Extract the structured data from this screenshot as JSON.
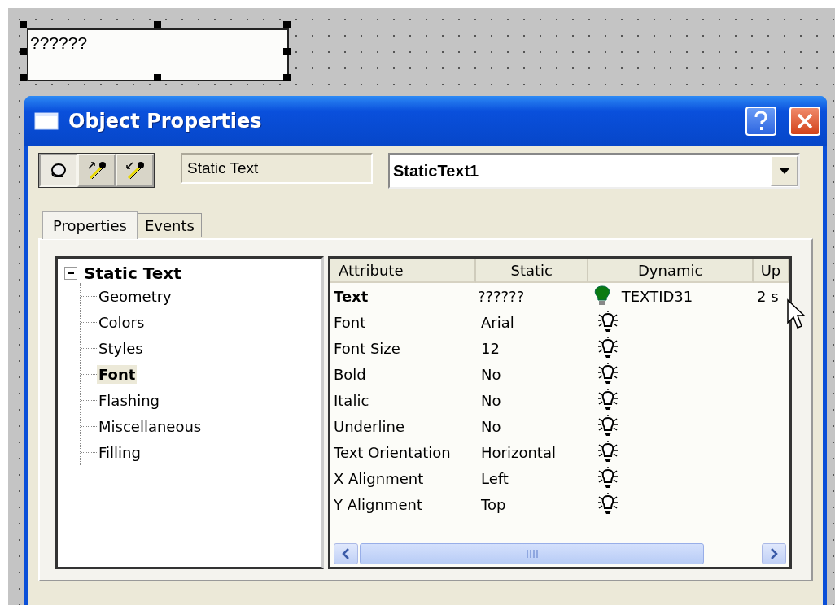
{
  "canvas": {
    "object_text": "??????",
    "object_selected": true
  },
  "window": {
    "title": "Object Properties"
  },
  "toolbar": {
    "buttons": [
      {
        "kind": "ball",
        "pressed": true
      },
      {
        "kind": "pipette-in",
        "pressed": false
      },
      {
        "kind": "pipette-out",
        "pressed": false
      }
    ],
    "object_type": "Static Text",
    "object_name": "StaticText1"
  },
  "tabs": [
    {
      "label": "Properties",
      "selected": true
    },
    {
      "label": "Events",
      "selected": false
    }
  ],
  "tree": {
    "label": "Static Text",
    "expanded": true,
    "children": [
      {
        "label": "Geometry",
        "selected": false
      },
      {
        "label": "Colors",
        "selected": false
      },
      {
        "label": "Styles",
        "selected": false
      },
      {
        "label": "Font",
        "selected": true
      },
      {
        "label": "Flashing",
        "selected": false
      },
      {
        "label": "Miscellaneous",
        "selected": false
      },
      {
        "label": "Filling",
        "selected": false
      }
    ]
  },
  "table": {
    "columns": [
      "Attribute",
      "Static",
      "Dynamic",
      "Up"
    ],
    "rows": [
      {
        "attribute": "Text",
        "bold": true,
        "static": "??????",
        "dynamic_on": true,
        "dynamic": "TEXTID31",
        "column_4": "2 s"
      },
      {
        "attribute": "Font",
        "bold": false,
        "static": "Arial",
        "dynamic_on": false
      },
      {
        "attribute": "Font Size",
        "bold": false,
        "static": "12",
        "dynamic_on": false
      },
      {
        "attribute": "Bold",
        "bold": false,
        "static": "No",
        "dynamic_on": false
      },
      {
        "attribute": "Italic",
        "bold": false,
        "static": "No",
        "dynamic_on": false
      },
      {
        "attribute": "Underline",
        "bold": false,
        "static": "No",
        "dynamic_on": false
      },
      {
        "attribute": "Text Orientation",
        "bold": false,
        "static": "Horizontal",
        "dynamic_on": false
      },
      {
        "attribute": "X Alignment",
        "bold": false,
        "static": "Left",
        "dynamic_on": false
      },
      {
        "attribute": "Y Alignment",
        "bold": false,
        "static": "Top",
        "dynamic_on": false
      }
    ]
  }
}
